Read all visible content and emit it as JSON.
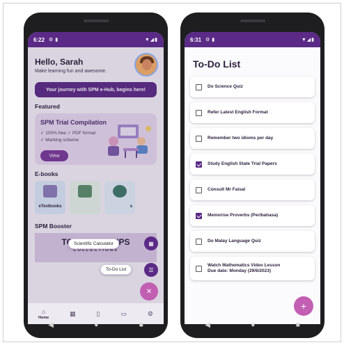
{
  "left_phone": {
    "status": {
      "time": "6:22",
      "icons": "▼◢▮"
    },
    "header": {
      "greeting": "Hello, Sarah",
      "subtitle": "Make learning fun and awesome."
    },
    "journey_banner": "Your journey with SPM e-Hub, begins here!",
    "featured": {
      "section_title": "Featured",
      "card_title": "SPM Trial Compilation",
      "points": [
        "✓ 100% free  ✓ PDF format",
        "✓ Marking scheme"
      ],
      "button": "View"
    },
    "ebooks": {
      "section_title": "E-books",
      "items": [
        {
          "label": "eTextbooks"
        },
        {
          "label": ""
        },
        {
          "label": "s"
        }
      ]
    },
    "fab_menu": {
      "calculator_label": "Scientific Calculator",
      "calculator_icon": "calculator-icon",
      "todo_label": "To-Do List",
      "todo_icon": "checklist-icon",
      "close_icon": "close-icon"
    },
    "booster": {
      "section_title": "SPM Booster",
      "banner_title": "TOP STUDY TIPS",
      "banner_subtitle": "COLLECTIONS"
    },
    "bottom_nav": [
      {
        "icon": "home-icon",
        "label": "Home"
      },
      {
        "icon": "grid-icon",
        "label": ""
      },
      {
        "icon": "document-icon",
        "label": ""
      },
      {
        "icon": "chat-icon",
        "label": ""
      },
      {
        "icon": "gear-icon",
        "label": ""
      }
    ]
  },
  "right_phone": {
    "status": {
      "time": "6:31",
      "icons": "▼◢▮"
    },
    "title": "To-Do List",
    "tasks": [
      {
        "text": "Do Science Quiz",
        "checked": false
      },
      {
        "text": "Refer Latest English Format",
        "checked": false
      },
      {
        "text": "Remember two idioms per day",
        "checked": false
      },
      {
        "text": "Study English State Trial Papers",
        "checked": true
      },
      {
        "text": "Consult Mr Faisal",
        "checked": false
      },
      {
        "text": "Memorise Proverbs (Peribahasa)",
        "checked": true
      },
      {
        "text": "Do Malay Language Quiz",
        "checked": false
      },
      {
        "text": "Watch Mathematics Video Lesson",
        "due": "Due date: Monday (29/6/2023)",
        "checked": false
      }
    ],
    "add_button": "+"
  },
  "colors": {
    "primary": "#5b2a86",
    "accent": "#c25fb3",
    "background": "#f4f0f7"
  }
}
